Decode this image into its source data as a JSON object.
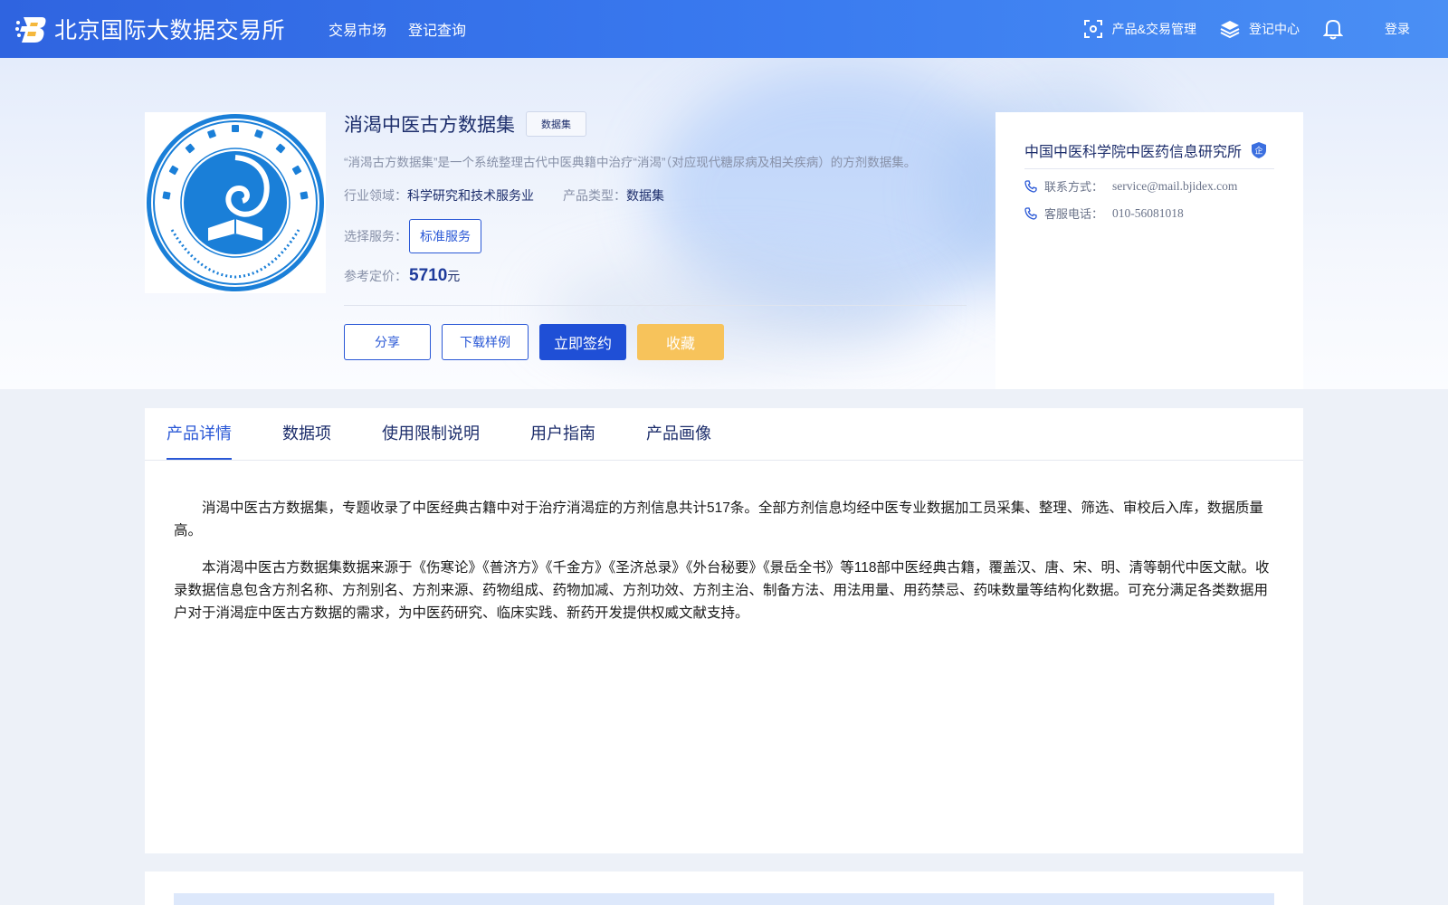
{
  "header": {
    "brand_name": "北京国际大数据交易所",
    "nav": [
      "交易市场",
      "登记查询"
    ],
    "right_nav": {
      "product_trade": "产品&交易管理",
      "register_center": "登记中心",
      "login": "登录"
    }
  },
  "product": {
    "logo_icon": "institute-seal-logo",
    "title": "消渴中医古方数据集",
    "tag": "数据集",
    "description": "“消渴古方数据集”是一个系统整理古代中医典籍中治疗“消渴”（对应现代糖尿病及相关疾病）的方剂数据集。",
    "industry_label": "行业领域：",
    "industry_value": "科学研究和技术服务业",
    "type_label": "产品类型：",
    "type_value": "数据集",
    "service_label": "选择服务：",
    "service_option": "标准服务",
    "price_label": "参考定价：",
    "price_value": "5710",
    "price_unit": "元",
    "actions": {
      "share": "分享",
      "download_sample": "下载样例",
      "sign": "立即签约",
      "favorite": "收藏"
    }
  },
  "company": {
    "name": "中国中医科学院中医药信息研究所",
    "badge": "企",
    "contact_label": "联系方式：",
    "contact_value": "service@mail.bjidex.com",
    "phone_label": "客服电话：",
    "phone_value": "010-56081018"
  },
  "tabs": [
    "产品详情",
    "数据项",
    "使用限制说明",
    "用户指南",
    "产品画像"
  ],
  "details": {
    "p1": "消渴中医古方数据集，专题收录了中医经典古籍中对于治疗消渴症的方剂信息共计517条。全部方剂信息均经中医专业数据加工员采集、整理、筛选、审校后入库，数据质量高。",
    "p2": "本消渴中医古方数据集数据来源于《伤寒论》《普济方》《千金方》《圣济总录》《外台秘要》《景岳全书》等118部中医经典古籍，覆盖汉、唐、宋、明、清等朝代中医文献。收录数据信息包含方剂名称、方剂别名、方剂来源、药物组成、药物加减、方剂功效、方剂主治、制备方法、用法用量、用药禁忌、药味数量等结构化数据。可充分满足各类数据用户对于消渴症中医古方数据的需求，为中医药研究、临床实践、新药开发提供权威文献支持。"
  },
  "colors": {
    "header_blue": "#2f64e0",
    "primary": "#1f4fd6",
    "accent_yellow": "#f7c35b",
    "seal_blue": "#1a7fd8"
  }
}
